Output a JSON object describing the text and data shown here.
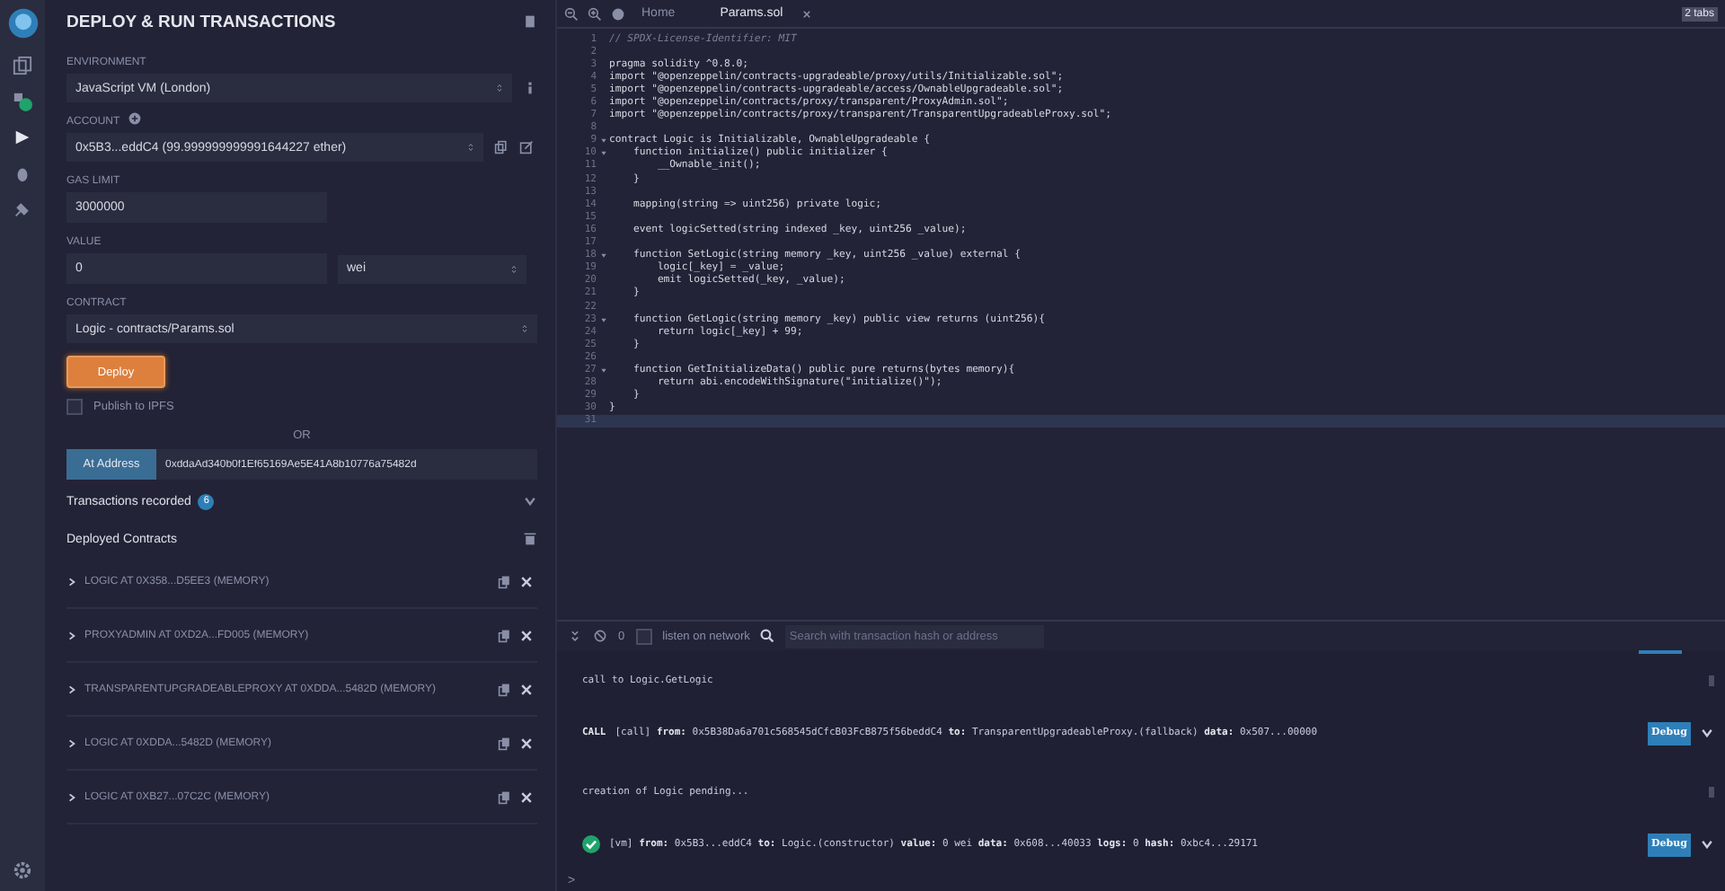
{
  "panel": {
    "title": "DEPLOY & RUN TRANSACTIONS",
    "environment": {
      "label": "ENVIRONMENT",
      "value": "JavaScript VM (London)"
    },
    "account": {
      "label": "ACCOUNT",
      "value": "0x5B3...eddC4 (99.999999999991644227 ether)"
    },
    "gas_limit": {
      "label": "GAS LIMIT",
      "value": "3000000"
    },
    "value": {
      "label": "VALUE",
      "amount": "0",
      "unit": "wei"
    },
    "contract": {
      "label": "CONTRACT",
      "value": "Logic - contracts/Params.sol"
    },
    "deploy_button": "Deploy",
    "publish": {
      "label": "Publish to IPFS",
      "checked": false
    },
    "or": "OR",
    "at_address": {
      "button": "At Address",
      "value": "0xddaAd340b0f1Ef65169Ae5E41A8b10776a75482d"
    },
    "transactions_recorded": {
      "label": "Transactions recorded",
      "count": "6"
    },
    "deployed_contracts": {
      "label": "Deployed Contracts",
      "items": [
        {
          "label": "LOGIC AT 0X358...D5EE3 (MEMORY)",
          "expanded": false
        },
        {
          "label": "PROXYADMIN AT 0XD2A...FD005 (MEMORY)",
          "expanded": false
        },
        {
          "label": "TRANSPARENTUPGRADEABLEPROXY AT 0XDDA...5482D (MEMORY)",
          "expanded": false
        },
        {
          "label": "LOGIC AT 0XDDA...5482D (MEMORY)",
          "expanded": false
        },
        {
          "label": "LOGIC AT 0XB27...07C2C (MEMORY)",
          "expanded": false
        }
      ]
    }
  },
  "editor": {
    "tabs": [
      {
        "label": "Home",
        "selected": false
      },
      {
        "label": "Params.sol",
        "selected": true
      }
    ],
    "tab_count": "2 tabs",
    "lines": [
      {
        "number": "1",
        "text": "// SPDX-License-Identifier: MIT",
        "kind": "comment",
        "fold": false
      },
      {
        "number": "2",
        "fold": false
      },
      {
        "number": "3",
        "text": "pragma solidity ^0.8.0;",
        "kind": "code",
        "fold": false
      },
      {
        "number": "4",
        "text": "import \"@openzeppelin/contracts-upgradeable/proxy/utils/Initializable.sol\";",
        "kind": "code",
        "fold": false
      },
      {
        "number": "5",
        "text": "import \"@openzeppelin/contracts-upgradeable/access/OwnableUpgradeable.sol\";",
        "kind": "code",
        "fold": false
      },
      {
        "number": "6",
        "text": "import \"@openzeppelin/contracts/proxy/transparent/ProxyAdmin.sol\";",
        "kind": "code",
        "fold": false
      },
      {
        "number": "7",
        "text": "import \"@openzeppelin/contracts/proxy/transparent/TransparentUpgradeableProxy.sol\";",
        "kind": "code",
        "fold": false
      },
      {
        "number": "8",
        "fold": false
      },
      {
        "number": "9",
        "text": "contract Logic is Initializable, OwnableUpgradeable {",
        "kind": "code",
        "fold": true
      },
      {
        "number": "10",
        "text": "    function initialize() public initializer {",
        "kind": "code",
        "fold": true
      },
      {
        "number": "11",
        "text": "        __Ownable_init();",
        "kind": "code",
        "fold": false
      },
      {
        "number": "12",
        "text": "    }",
        "kind": "code",
        "fold": false
      },
      {
        "number": "13",
        "fold": false
      },
      {
        "number": "14",
        "text": "    mapping(string => uint256) private logic;",
        "kind": "code",
        "fold": false
      },
      {
        "number": "15",
        "fold": false
      },
      {
        "number": "16",
        "text": "    event logicSetted(string indexed _key, uint256 _value);",
        "kind": "code",
        "fold": false
      },
      {
        "number": "17",
        "fold": false
      },
      {
        "number": "18",
        "text": "    function SetLogic(string memory _key, uint256 _value) external {",
        "kind": "code",
        "fold": true
      },
      {
        "number": "19",
        "text": "        logic[_key] = _value;",
        "kind": "code",
        "fold": false
      },
      {
        "number": "20",
        "text": "        emit logicSetted(_key, _value);",
        "kind": "code",
        "fold": false
      },
      {
        "number": "21",
        "text": "    }",
        "kind": "code",
        "fold": false
      },
      {
        "number": "22",
        "fold": false
      },
      {
        "number": "23",
        "text": "    function GetLogic(string memory _key) public view returns (uint256){",
        "kind": "code",
        "fold": true
      },
      {
        "number": "24",
        "text": "        return logic[_key] + 99;",
        "kind": "code",
        "fold": false
      },
      {
        "number": "25",
        "text": "    }",
        "kind": "code",
        "fold": false
      },
      {
        "number": "26",
        "fold": false
      },
      {
        "number": "27",
        "text": "    function GetInitializeData() public pure returns(bytes memory){",
        "kind": "code",
        "fold": true
      },
      {
        "number": "28",
        "text": "        return abi.encodeWithSignature(\"initialize()\");",
        "kind": "code",
        "fold": false
      },
      {
        "number": "29",
        "text": "    }",
        "kind": "code",
        "fold": false
      },
      {
        "number": "30",
        "text": "}",
        "kind": "code",
        "fold": false
      },
      {
        "number": "31",
        "fold": false
      }
    ]
  },
  "terminal": {
    "count": "0",
    "listen": {
      "label": "listen on network",
      "checked": false
    },
    "search": {
      "placeholder": "Search with transaction hash or address"
    },
    "entries": [
      {
        "kind": "log",
        "text": "call to Logic.GetLogic"
      },
      {
        "kind": "call",
        "status": "CALL",
        "text": "[call] **from:** 0x5B38Da6a701c568545dCfcB03FcB875f56beddC4 **to:** TransparentUpgradeableProxy.(fallback) **data:** 0x507...00000",
        "button": "Debug"
      },
      {
        "kind": "log",
        "text": "creation of Logic pending..."
      },
      {
        "kind": "success",
        "text": "[vm] **from:** 0x5B3...eddC4 **to:** Logic.(constructor) **value:** 0 wei **data:** 0x608...40033 **logs:** 0 **hash:** 0xbc4...29171",
        "button": "Debug"
      }
    ],
    "prompt": ">"
  }
}
